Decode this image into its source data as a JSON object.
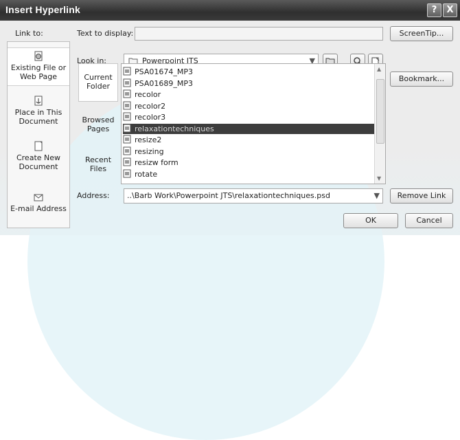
{
  "window": {
    "title": "Insert Hyperlink",
    "help_label": "?",
    "close_label": "X"
  },
  "link_to": {
    "label": "Link to:",
    "items": [
      {
        "label_line1": "Existing File or",
        "label_line2": "Web Page"
      },
      {
        "label_line1": "Place in This",
        "label_line2": "Document"
      },
      {
        "label_line1": "Create New",
        "label_line2": "Document"
      },
      {
        "label_line1": "E-mail Address",
        "label_line2": ""
      }
    ]
  },
  "text_to_display": {
    "label": "Text to display:",
    "value": ""
  },
  "screentip_button": "ScreenTip...",
  "look_in": {
    "label": "Look in:",
    "value": "Powerpoint JTS"
  },
  "subnav": [
    {
      "line1": "Current",
      "line2": "Folder"
    },
    {
      "line1": "Browsed",
      "line2": "Pages"
    },
    {
      "line1": "Recent",
      "line2": "Files"
    }
  ],
  "files": [
    "PSA01674_MP3",
    "PSA01689_MP3",
    "recolor",
    "recolor2",
    "recolor3",
    "relaxationtechniques",
    "resize2",
    "resizing",
    "resizw form",
    "rotate"
  ],
  "selected_file_index": 5,
  "bookmark_button": "Bookmark...",
  "address": {
    "label": "Address:",
    "value": "..\\Barb Work\\Powerpoint JTS\\relaxationtechniques.psd"
  },
  "remove_link_button": "Remove Link",
  "ok_button": "OK",
  "cancel_button": "Cancel"
}
